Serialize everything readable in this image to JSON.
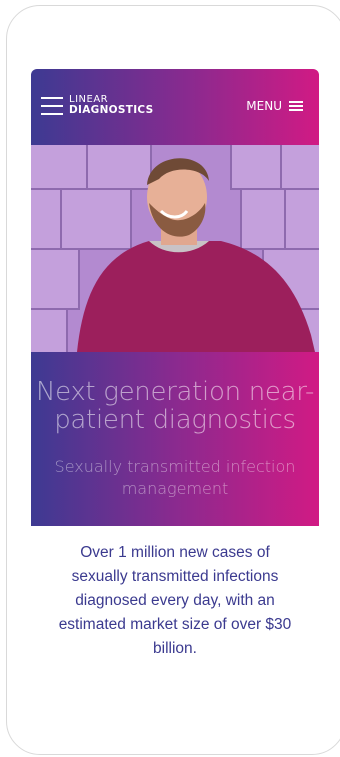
{
  "brand": {
    "name_line1": "LINEAR",
    "name_line2": "DIAGNOSTICS"
  },
  "nav": {
    "menu_label": "MENU"
  },
  "hero": {
    "image_alt": "Smiling man in maroon sweater against stone wall",
    "headline": "Next generation near-patient diagnostics",
    "subheadline": "Sexually transmitted infection management"
  },
  "intro": {
    "text": "Over 1 million new cases of sexually transmitted infections diagnosed every day, with an estimated market size of over $30 billion."
  },
  "colors": {
    "gradient_start": "#3d3a92",
    "gradient_end": "#d11a84",
    "body_text": "#3b3a8f"
  }
}
